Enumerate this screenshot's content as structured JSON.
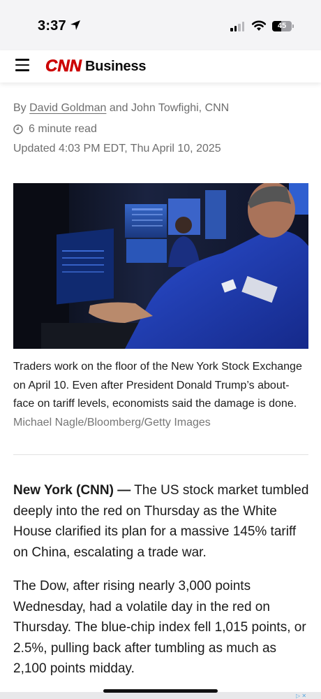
{
  "status_bar": {
    "time": "3:37",
    "battery": "45",
    "battery_level": 0.45,
    "icons": [
      "location-arrow-icon",
      "cellular-signal-icon",
      "wifi-icon",
      "battery-icon"
    ]
  },
  "header": {
    "logo_text": "CNN",
    "section": "Business",
    "logo_color": "#cc0000"
  },
  "byline": {
    "prefix": "By",
    "author1": "David Goldman",
    "joiner": "and",
    "author2": "John Towfighi, CNN"
  },
  "read_time": "6 minute read",
  "updated": "Updated 4:03 PM EDT, Thu April 10, 2025",
  "image": {
    "caption": "Traders work on the floor of the New York Stock Exchange on April 10. Even after President Donald Trump’s about-face on tariff levels, economists said the damage is done.",
    "credit": "Michael Nagle/Bloomberg/Getty Images"
  },
  "article": {
    "para1_dateline": "New York (CNN) —",
    "para1_text": "The US stock market tumbled deeply into the red on Thursday as the White House clarified its plan for a massive 145% tariff on China, escalating a trade war.",
    "para2_text": "The Dow, after rising nearly 3,000 points Wednesday, had a volatile day in the red on Thursday. The blue-chip index fell 1,015 points, or 2.5%, pulling back after tumbling as much as 2,100 points midday."
  },
  "ad": {
    "icons": [
      "adchoices-icon",
      "close-icon"
    ]
  }
}
